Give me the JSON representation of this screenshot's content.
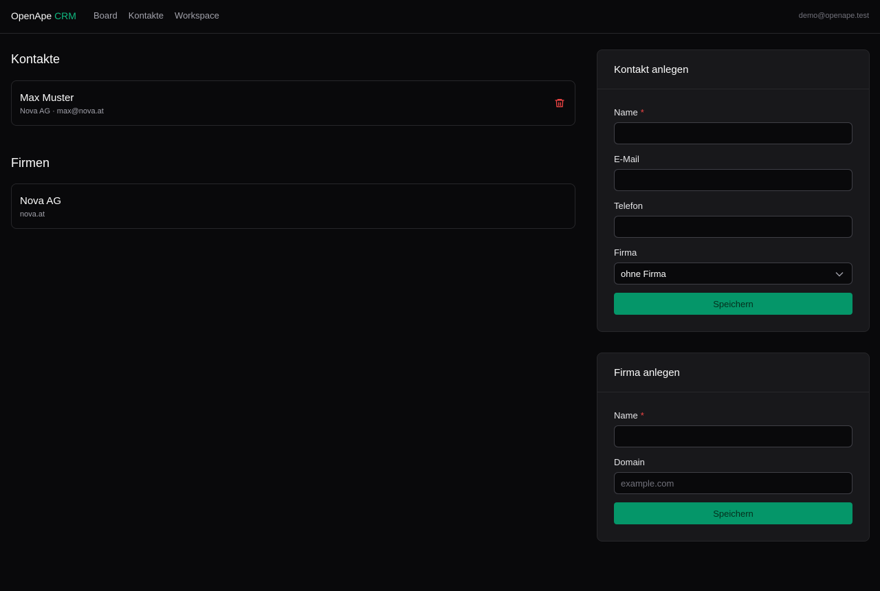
{
  "header": {
    "brand_main": "OpenApe",
    "brand_accent": "CRM",
    "nav": [
      "Board",
      "Kontakte",
      "Workspace"
    ],
    "user_email": "demo@openape.test"
  },
  "contacts": {
    "title": "Kontakte",
    "items": [
      {
        "name": "Max Muster",
        "details": "Nova AG · max@nova.at"
      }
    ]
  },
  "companies": {
    "title": "Firmen",
    "items": [
      {
        "name": "Nova AG",
        "domain": "nova.at"
      }
    ]
  },
  "contact_form": {
    "title": "Kontakt anlegen",
    "name_label": "Name",
    "required_mark": "*",
    "email_label": "E-Mail",
    "phone_label": "Telefon",
    "company_label": "Firma",
    "company_selected": "ohne Firma",
    "name_value": "",
    "email_value": "",
    "phone_value": "",
    "submit_label": "Speichern"
  },
  "company_form": {
    "title": "Firma anlegen",
    "name_label": "Name",
    "required_mark": "*",
    "domain_label": "Domain",
    "domain_placeholder": "example.com",
    "name_value": "",
    "domain_value": "",
    "submit_label": "Speichern"
  },
  "colors": {
    "accent": "#10b981",
    "button": "#059669",
    "danger": "#ef4444",
    "background": "#09090b",
    "panel": "#18181b"
  },
  "icons": {
    "delete": "trash-icon",
    "select": "chevron-down-icon"
  }
}
